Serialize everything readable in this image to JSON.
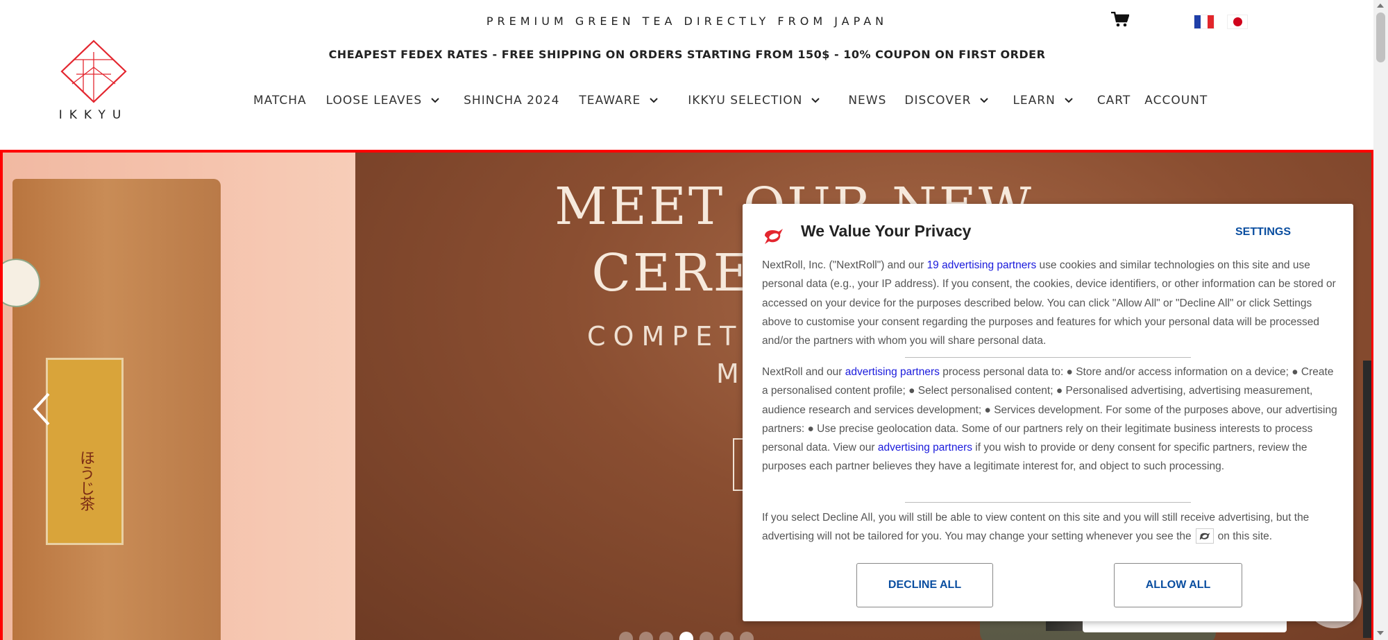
{
  "header": {
    "tagline": "PREMIUM GREEN TEA DIRECTLY FROM JAPAN",
    "promo": "CHEAPEST FEDEX RATES - FREE SHIPPING ON ORDERS STARTING FROM 150$ - 10% COUPON ON FIRST ORDER",
    "logo_text": "IKKYU",
    "cart_icon": "shopping-cart-icon",
    "flags": [
      "france-flag",
      "japan-flag"
    ]
  },
  "nav": {
    "items": [
      {
        "label": "MATCHA",
        "dropdown": false
      },
      {
        "label": "LOOSE LEAVES",
        "dropdown": true
      },
      {
        "label": "SHINCHA 2024",
        "dropdown": false
      },
      {
        "label": "TEAWARE",
        "dropdown": true
      },
      {
        "label": "IKKYU SELECTION",
        "dropdown": true
      },
      {
        "label": "NEWS",
        "dropdown": false
      },
      {
        "label": "DISCOVER",
        "dropdown": true
      },
      {
        "label": "LEARN",
        "dropdown": true
      },
      {
        "label": "CART",
        "dropdown": false
      },
      {
        "label": "ACCOUNT",
        "dropdown": false
      }
    ]
  },
  "hero": {
    "title_line1": "MEET OUR NEW",
    "title_line2": "CEREMONIAL",
    "subtitle_line1": "COMPETITION GRADE",
    "subtitle_line2": "MATCHA",
    "tea_label_text": "ほうじ茶",
    "slide_count": 7,
    "active_slide": 4
  },
  "consent": {
    "title": "We Value Your Privacy",
    "settings_label": "SETTINGS",
    "p1_before": "NextRoll, Inc. (\"NextRoll\") and our ",
    "p1_link": "19 advertising partners",
    "p1_after": " use cookies and similar technologies on this site and use personal data (e.g., your IP address). If you consent, the cookies, device identifiers, or other information can be stored or accessed on your device for the purposes described below. You can click \"Allow All\" or \"Decline All\" or click Settings above to customise your consent regarding the purposes and features for which your personal data will be processed and/or the partners with whom you will share personal data.",
    "p2_before": "NextRoll and our ",
    "p2_link1": "advertising partners",
    "p2_middle": " process personal data to: ● Store and/or access information on a device; ● Create a personalised content profile; ● Select personalised content; ● Personalised advertising, advertising measurement, audience research and services development; ● Services development. For some of the purposes above, our advertising partners: ● Use precise geolocation data. Some of our partners rely on their legitimate business interests to process personal data. View our ",
    "p2_link2": "advertising partners",
    "p2_after": " if you wish to provide or deny consent for specific partners, review the purposes each partner believes they have a legitimate interest for, and object to such processing.",
    "p3_before": "If you select Decline All, you will still be able to view content on this site and you will still receive advertising, but the advertising will not be tailored for you. You may change your setting whenever you see the",
    "p3_after": "on this site.",
    "decline_label": "DECLINE ALL",
    "allow_label": "ALLOW ALL"
  },
  "colors": {
    "brand_red": "#e3262f",
    "link_blue": "#1a1adc",
    "button_text": "#0a4ea0",
    "hero_border": "#ff0000"
  }
}
